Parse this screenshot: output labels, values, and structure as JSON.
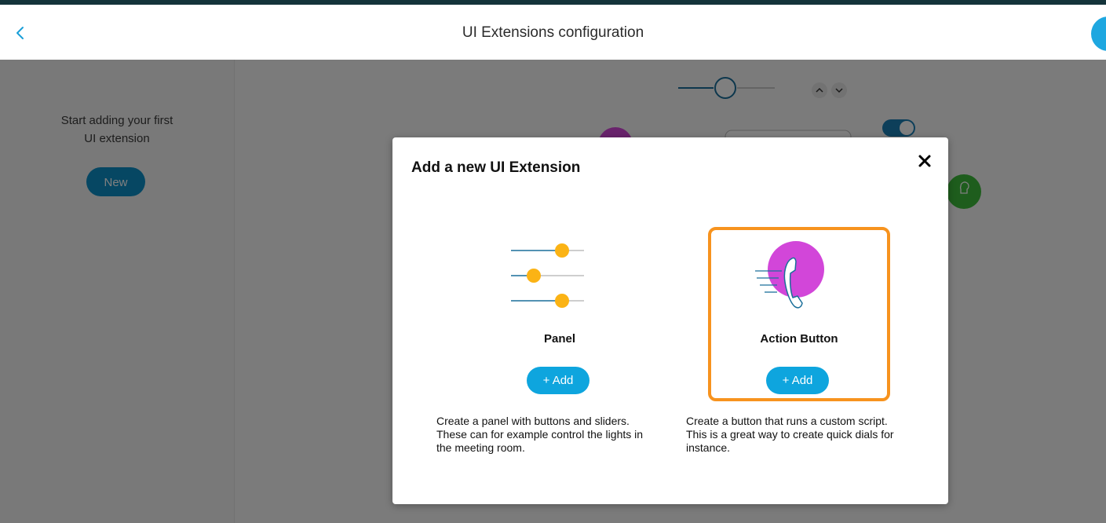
{
  "header": {
    "title": "UI Extensions configuration"
  },
  "sidebar": {
    "hint_line1": "Start adding your first",
    "hint_line2": "UI extension",
    "new_label": "New"
  },
  "modal": {
    "title": "Add a new UI Extension",
    "options": [
      {
        "name": "Panel",
        "add_label": "+ Add",
        "description": "Create a panel with buttons and sliders. These can for example control the lights in the meeting room.",
        "selected": false
      },
      {
        "name": "Action Button",
        "add_label": "+ Add",
        "description": "Create a button that runs a custom script. This is a great way to create quick dials for instance.",
        "selected": true
      }
    ]
  },
  "colors": {
    "accent": "#0ea5de",
    "highlight": "#f7931e",
    "slider_knob": "#fbb315",
    "action_circle": "#d246d9",
    "header_rule": "#14343a"
  },
  "icons": {
    "back": "chevron-left-icon",
    "close": "close-icon",
    "panel": "sliders-icon",
    "action": "phone-icon"
  }
}
